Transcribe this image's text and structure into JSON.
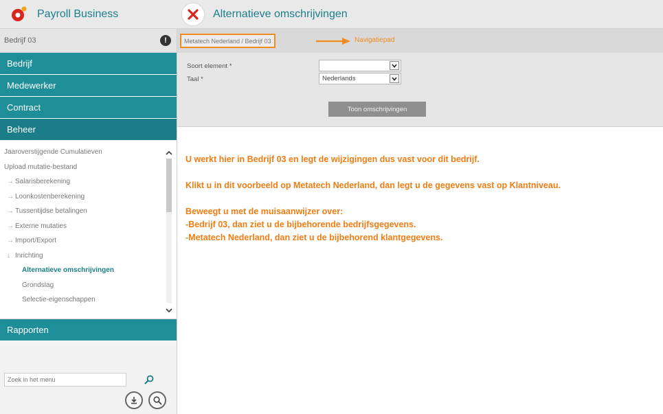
{
  "app": {
    "brand": "Payroll Business",
    "page_title": "Alternatieve omschrijvingen"
  },
  "sidebar": {
    "company": "Bedrijf 03",
    "sections": [
      "Bedrijf",
      "Medewerker",
      "Contract",
      "Beheer"
    ],
    "menu_items": [
      {
        "label": "Jaaroverstijgende Cumulatieven",
        "arrow": ""
      },
      {
        "label": "Upload mutatie-bestand",
        "arrow": ""
      },
      {
        "label": "Salarisberekening",
        "arrow": "→"
      },
      {
        "label": "Loonkostenberekening",
        "arrow": "→"
      },
      {
        "label": "Tussentijdse betalingen",
        "arrow": "→"
      },
      {
        "label": "Externe mutaties",
        "arrow": "→"
      },
      {
        "label": "Import/Export",
        "arrow": "→"
      },
      {
        "label": "Inrichting",
        "arrow": "↓"
      },
      {
        "label": "Alternatieve omschrijvingen",
        "arrow": ""
      },
      {
        "label": "Grondslag",
        "arrow": ""
      },
      {
        "label": "Selectie-eigenschappen",
        "arrow": ""
      }
    ],
    "reports": "Rapporten",
    "search_placeholder": "Zoek in het menu"
  },
  "main": {
    "breadcrumb": "Metatech Nederland / Bedrijf 03",
    "breadcrumb_note": "Navigatiepad",
    "filters": {
      "element_label": "Soort element *",
      "element_value": "",
      "language_label": "Taal *",
      "language_value": "Nederlands",
      "show_button": "Toon omschrijvingen"
    },
    "notes": [
      "U werkt hier in Bedrijf 03 en legt de wijzigingen dus vast voor dit bedrijf.",
      "Klikt u in dit voorbeeld op Metatech Nederland, dan legt u de gegevens vast op Klantniveau.",
      "Beweegt u met de muisaanwijzer over:",
      "-Bedrijf 03, dan ziet u de bijbehorende bedrijfsgegevens.",
      "-Metatech Nederland, dan ziet u de bijbehorend klantgegevens."
    ]
  },
  "colors": {
    "teal": "#1e8e99",
    "teal_dark": "#1a7d87",
    "orange": "#f07d13",
    "header_text": "#1a7f8a"
  },
  "icons": [
    "payroll-logo-icon",
    "close-x-icon",
    "info-icon",
    "search-icon",
    "scroll-up-icon",
    "scroll-down-icon",
    "dropdown-icon",
    "download-icon",
    "help-icon"
  ]
}
